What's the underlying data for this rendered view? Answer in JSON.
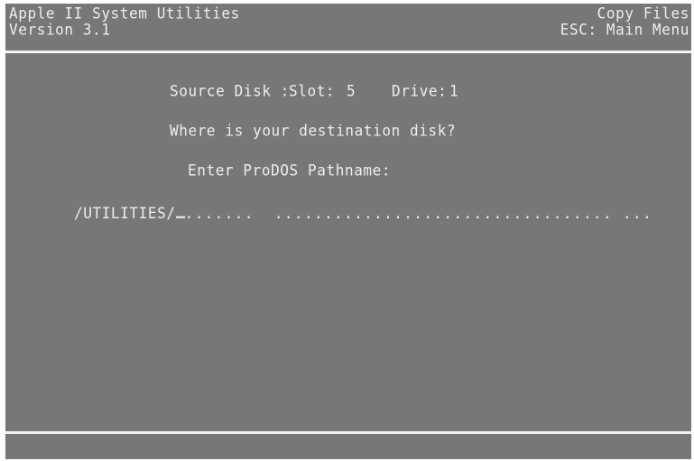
{
  "header": {
    "app_title": "Apple II System Utilities",
    "version": "Version 3.1",
    "screen_title": "Copy Files",
    "esc_hint": "ESC: Main Menu"
  },
  "main": {
    "source_label": "Source Disk :",
    "slot_label": "Slot:",
    "slot_value": "5",
    "drive_label": "Drive:",
    "drive_value": "1",
    "prompt_question": "Where is your destination disk?",
    "pathname_prompt": "Enter ProDOS Pathname:",
    "pathname_value": "/UTILITIES/",
    "pathname_fill": ".......  .................................. ..."
  }
}
